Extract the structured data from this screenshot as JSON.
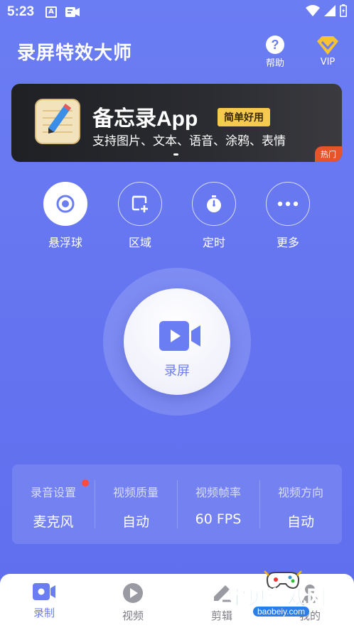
{
  "status_bar": {
    "time": "5:23",
    "a_icon": "A"
  },
  "header": {
    "title": "录屏特效大师",
    "help_label": "帮助",
    "help_glyph": "?",
    "vip_label": "VIP"
  },
  "banner": {
    "title": "备忘录App",
    "tag": "简单好用",
    "subtitle": "支持图片、文本、语音、涂鸦、表情",
    "hot_label": "热门"
  },
  "tools": [
    {
      "label": "悬浮球",
      "icon": "target-icon"
    },
    {
      "label": "区域",
      "icon": "area-add-icon"
    },
    {
      "label": "定时",
      "icon": "timer-icon"
    },
    {
      "label": "更多",
      "icon": "more-dots-icon"
    }
  ],
  "record": {
    "label": "录屏"
  },
  "settings": [
    {
      "label": "录音设置",
      "value": "麦克风",
      "badge": true
    },
    {
      "label": "视频质量",
      "value": "自动"
    },
    {
      "label": "视频帧率",
      "value": "60 FPS"
    },
    {
      "label": "视频方向",
      "value": "自动"
    }
  ],
  "nav": [
    {
      "label": "录制",
      "active": true
    },
    {
      "label": "视频"
    },
    {
      "label": "剪辑"
    },
    {
      "label": "我的"
    }
  ],
  "watermark": {
    "text": "宝贝游戏网",
    "url": "baobeiy.com"
  },
  "colors": {
    "accent": "#6b7df3",
    "banner_tag": "#f6c94f",
    "hot": "#e8542a",
    "badge": "#ff4a3d"
  }
}
